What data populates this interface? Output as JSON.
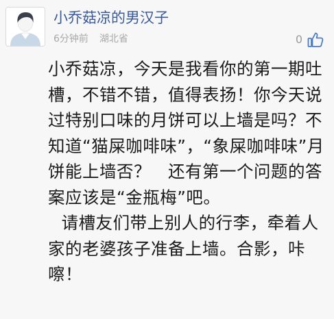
{
  "comment": {
    "username": "小乔菇凉的男汉子",
    "time": "6分钟前",
    "location": "湖北省",
    "like_count": "0",
    "paragraphs": [
      "小乔菇凉，今天是我看你的第一期吐槽，不错不错，值得表扬！你今天说过特别口味的月饼可以上墙是吗？不知道“猫屎咖啡味”，“象屎咖啡味”月饼能上墙否？　还有第一个问题的答案应该是“金瓶梅”吧。",
      "请槽友们带上别人的行李，牵着人家的老婆孩子准备上墙。合影，咔嚓！"
    ]
  },
  "colors": {
    "username": "#3a5a9a",
    "meta": "#a8a8a8",
    "body_text": "#1a1a1a",
    "like_icon": "#4a7cc9",
    "background": "#f7f7f7"
  },
  "icons": {
    "avatar": "default-user-avatar",
    "like": "thumbs-up-icon"
  }
}
